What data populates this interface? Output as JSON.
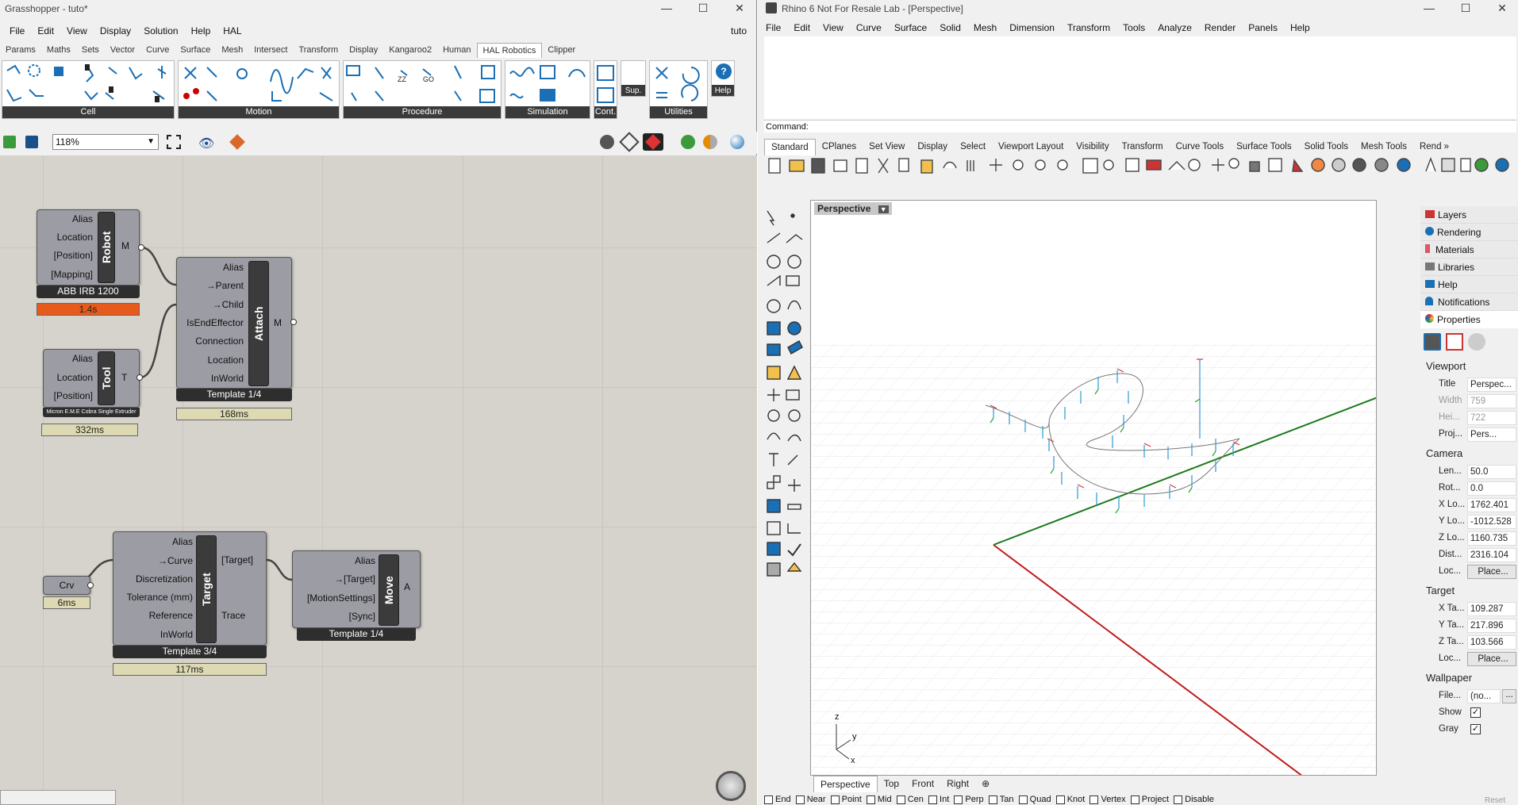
{
  "gh": {
    "title": "Grasshopper - tuto*",
    "doc_name": "tuto",
    "menu": [
      "File",
      "Edit",
      "View",
      "Display",
      "Solution",
      "Help",
      "HAL"
    ],
    "tabs": [
      "Params",
      "Maths",
      "Sets",
      "Vector",
      "Curve",
      "Surface",
      "Mesh",
      "Intersect",
      "Transform",
      "Display",
      "Kangaroo2",
      "Human",
      "HAL Robotics",
      "Clipper"
    ],
    "ribbon_groups": [
      "Cell",
      "Motion",
      "Procedure",
      "Simulation",
      "Cont.",
      "Utilities"
    ],
    "sup_label": "Sup.",
    "help_label": "Help",
    "zoom": "118%",
    "robot": {
      "inputs": [
        "Alias",
        "Location",
        "[Position]",
        "[Mapping]"
      ],
      "nick": "Robot",
      "out": "M",
      "footer": "ABB IRB 1200",
      "timer": "1.4s"
    },
    "tool": {
      "inputs": [
        "Alias",
        "Location",
        "[Position]"
      ],
      "nick": "Tool",
      "out": "T",
      "footer": "Micron E.M.E Cobra Single Extruder",
      "timer": "332ms"
    },
    "attach": {
      "inputs": [
        "Alias",
        "→Parent",
        "→Child",
        "IsEndEffector",
        "Connection",
        "Location",
        "InWorld"
      ],
      "nick": "Attach",
      "out": "M",
      "footer": "Template 1/4",
      "timer": "168ms"
    },
    "crv": {
      "label": "Crv",
      "timer": "6ms"
    },
    "target": {
      "inputs": [
        "Alias",
        "→Curve",
        "Discretization",
        "Tolerance (mm)",
        "Reference",
        "InWorld"
      ],
      "nick": "Target",
      "outputs": [
        "[Target]",
        "Trace"
      ],
      "footer": "Template 3/4",
      "timer": "117ms"
    },
    "move": {
      "inputs": [
        "Alias",
        "→[Target]",
        "[MotionSettings]",
        "[Sync]"
      ],
      "nick": "Move",
      "out": "A",
      "footer": "Template 1/4"
    }
  },
  "rhino": {
    "title": "Rhino 6 Not For Resale Lab - [Perspective]",
    "menu": [
      "File",
      "Edit",
      "View",
      "Curve",
      "Surface",
      "Solid",
      "Mesh",
      "Dimension",
      "Transform",
      "Tools",
      "Analyze",
      "Render",
      "Panels",
      "Help"
    ],
    "command_label": "Command:",
    "toolbar_tabs": [
      "Standard",
      "CPlanes",
      "Set View",
      "Display",
      "Select",
      "Viewport Layout",
      "Visibility",
      "Transform",
      "Curve Tools",
      "Surface Tools",
      "Solid Tools",
      "Mesh Tools",
      "Rend »"
    ],
    "viewport_label": "Perspective",
    "view_tabs": [
      "Perspective",
      "Top",
      "Front",
      "Right"
    ],
    "panel_tabs": [
      "Layers",
      "Rendering",
      "Materials",
      "Libraries",
      "Help",
      "Notifications",
      "Properties"
    ],
    "viewport_section": "Viewport",
    "viewport_props": [
      {
        "k": "Title",
        "v": "Perspec..."
      },
      {
        "k": "Width",
        "v": "759"
      },
      {
        "k": "Hei...",
        "v": "722"
      },
      {
        "k": "Proj...",
        "v": "Pers..."
      }
    ],
    "camera_section": "Camera",
    "camera_props": [
      {
        "k": "Len...",
        "v": "50.0"
      },
      {
        "k": "Rot...",
        "v": "0.0"
      },
      {
        "k": "X Lo...",
        "v": "1762.401"
      },
      {
        "k": "Y Lo...",
        "v": "-1012.528"
      },
      {
        "k": "Z Lo...",
        "v": "1160.735"
      },
      {
        "k": "Dist...",
        "v": "2316.104"
      },
      {
        "k": "Loc...",
        "v": "Place..."
      }
    ],
    "target_section": "Target",
    "target_props": [
      {
        "k": "X Ta...",
        "v": "109.287"
      },
      {
        "k": "Y Ta...",
        "v": "217.896"
      },
      {
        "k": "Z Ta...",
        "v": "103.566"
      },
      {
        "k": "Loc...",
        "v": "Place..."
      }
    ],
    "wallpaper_section": "Wallpaper",
    "wallpaper_props": [
      {
        "k": "File...",
        "v": "(no..."
      },
      {
        "k": "Show",
        "v": ""
      },
      {
        "k": "Gray",
        "v": ""
      }
    ],
    "snaps": [
      "End",
      "Near",
      "Point",
      "Mid",
      "Cen",
      "Int",
      "Perp",
      "Tan",
      "Quad",
      "Knot",
      "Vertex",
      "Project",
      "Disable"
    ],
    "axis_labels": {
      "z": "z",
      "y": "y",
      "x": "x"
    },
    "cut_label": "Reset"
  }
}
